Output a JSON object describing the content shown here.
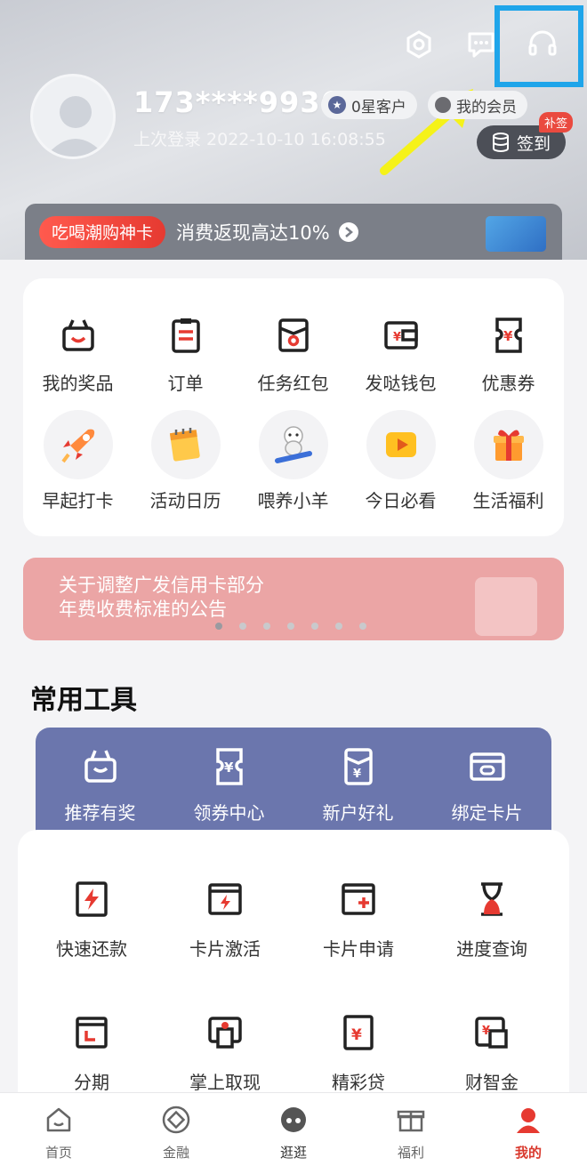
{
  "header": {
    "phone": "173****9936",
    "star_badge": "0星客户",
    "member_badge": "我的会员",
    "last_login": "上次登录 2022-10-10 16:08:55",
    "checkin_label": "签到",
    "checkin_tag": "补签",
    "icons": [
      "settings-icon",
      "message-icon",
      "headset-icon"
    ]
  },
  "promo": {
    "tag": "吃喝潮购神卡",
    "text": "消费返现高达10%"
  },
  "quick_grid": [
    {
      "label": "我的奖品",
      "icon": "prize-basket-icon"
    },
    {
      "label": "订单",
      "icon": "clipboard-icon"
    },
    {
      "label": "任务红包",
      "icon": "red-envelope-icon"
    },
    {
      "label": "发哒钱包",
      "icon": "wallet-icon"
    },
    {
      "label": "优惠券",
      "icon": "coupon-icon"
    },
    {
      "label": "早起打卡",
      "icon": "rocket-icon"
    },
    {
      "label": "活动日历",
      "icon": "calendar-icon"
    },
    {
      "label": "喂养小羊",
      "icon": "sheep-icon"
    },
    {
      "label": "今日必看",
      "icon": "play-icon"
    },
    {
      "label": "生活福利",
      "icon": "gift-icon"
    }
  ],
  "notice": {
    "line1": "关于调整广发信用卡部分",
    "line2": "年费收费标准的公告",
    "dots_total": 7,
    "active_dot": 1
  },
  "tools": {
    "title": "常用工具",
    "featured": [
      {
        "label": "推荐有奖",
        "icon": "basket-icon"
      },
      {
        "label": "领券中心",
        "icon": "coupon-icon"
      },
      {
        "label": "新户好礼",
        "icon": "new-user-gift-icon"
      },
      {
        "label": "绑定卡片",
        "icon": "bind-card-icon"
      }
    ],
    "items": [
      {
        "label": "快速还款",
        "icon": "fast-repay-icon"
      },
      {
        "label": "卡片激活",
        "icon": "card-activate-icon"
      },
      {
        "label": "卡片申请",
        "icon": "card-apply-icon"
      },
      {
        "label": "进度查询",
        "icon": "hourglass-icon"
      },
      {
        "label": "分期",
        "icon": "installment-icon"
      },
      {
        "label": "掌上取现",
        "icon": "cash-withdraw-icon"
      },
      {
        "label": "精彩贷",
        "icon": "loan-icon"
      },
      {
        "label": "财智金",
        "icon": "finance-gold-icon"
      }
    ]
  },
  "bottom_nav": [
    {
      "label": "首页",
      "icon": "home-icon"
    },
    {
      "label": "金融",
      "icon": "finance-icon"
    },
    {
      "label": "逛逛",
      "icon": "browse-icon"
    },
    {
      "label": "福利",
      "icon": "gift-icon"
    },
    {
      "label": "我的",
      "icon": "profile-icon",
      "active": true
    }
  ],
  "colors": {
    "accent_red": "#e63a31",
    "tools_band": "#6b76ad",
    "highlight_box": "#1fa5ea",
    "annotation_arrow": "#f5f219"
  }
}
